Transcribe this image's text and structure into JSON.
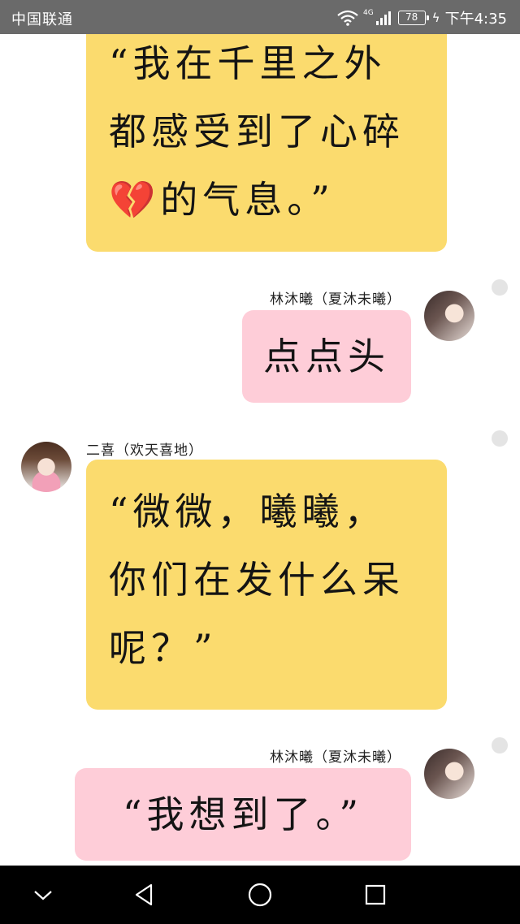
{
  "status_bar": {
    "carrier": "中国联通",
    "network_type": "4G",
    "battery": "78",
    "time": "下午4:35",
    "icons": [
      "wifi-icon",
      "signal-icon",
      "battery-icon",
      "charging-icon"
    ]
  },
  "messages": [
    {
      "sender": "",
      "side": "left",
      "color": "#fbdb6e",
      "emoji": "💔",
      "text": "“我在千里之外\n都感受到了心碎\n💔的气息。”"
    },
    {
      "sender": "林沐曦（夏沐未曦）",
      "side": "right",
      "color": "#fecdd8",
      "text": "点点头"
    },
    {
      "sender": "二喜（欢天喜地）",
      "side": "left",
      "color": "#fbdb6e",
      "text": "“微微，曦曦，\n你们在发什么呆\n呢？”"
    },
    {
      "sender": "林沐曦（夏沐未曦）",
      "side": "right",
      "color": "#fecdd8",
      "text": "“我想到了。”"
    }
  ],
  "nav_bar": {
    "buttons": [
      "collapse-icon",
      "back-icon",
      "home-icon",
      "recents-icon"
    ]
  }
}
